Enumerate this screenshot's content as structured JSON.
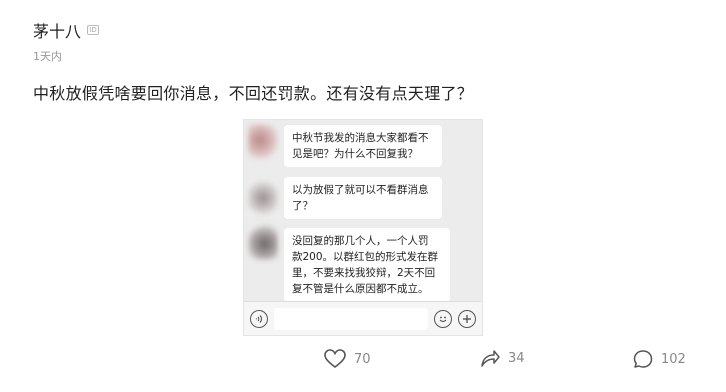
{
  "post": {
    "author": "茅十八",
    "id_badge": "ID",
    "time": "1天内",
    "text": "中秋放假凭啥要回你消息，不回还罚款。还有没有点天理了？"
  },
  "chat": {
    "messages": [
      "中秋节我发的消息大家都看不\n见是吧？为什么不回复我？",
      "以为放假了就可以不看群消息\n了？",
      "没回复的那几个人，一个人罚\n款200。以群红包的形式发在群\n里，不要来找我狡辩，2天不回\n复不管是什么原因都不成立。"
    ]
  },
  "actions": {
    "likes": "70",
    "shares": "34",
    "comments": "102"
  },
  "icons": {
    "like": "heart-outline-icon",
    "share": "share-arrow-icon",
    "comment": "comment-bubble-icon",
    "voice": "voice-icon",
    "emoji": "emoji-icon",
    "plus": "plus-icon"
  }
}
